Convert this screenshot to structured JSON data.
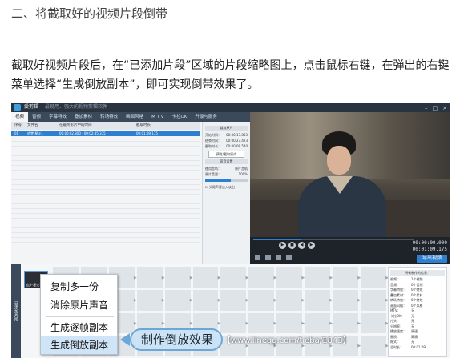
{
  "article": {
    "heading": "二、将截取好的视频片段倒带",
    "paragraph": "截取好视频片段后，在“已添加片段”区域的片段缩略图上，点击鼠标右键，在弹出的右键菜单选择“生成倒放副本”，即可实现倒带效果了。"
  },
  "app": {
    "title": "爱剪辑",
    "subtitle": "最易用、强大的视频剪辑软件",
    "tabs": [
      "视频",
      "音频",
      "字幕特效",
      "叠加素材",
      "转场特效",
      "画面风格",
      "M T V",
      "卡拉OK",
      "升级与服务"
    ],
    "table_headers": [
      "序号",
      "文件名",
      "在最终影片中的时间",
      "截取时长"
    ],
    "selected_row": [
      "01",
      "追梦·星火1",
      "00:00:02.800 - 00:02:35.375",
      "00:01:09.175"
    ],
    "side_panel": {
      "section1": "裁剪原片",
      "start_label": "开始时间：",
      "start_value": "00:00:17.883",
      "end_label": "结束时间：",
      "end_value": "00:00:27.423",
      "dur_label": "截取时长：",
      "dur_value": "00:00:09.540",
      "preview_btn": "预览/截取原片",
      "section2": "声音设置",
      "track_label": "使用音轨：",
      "track_value": "原片音轨",
      "vol_label": "原片音量：",
      "vol_value": "100%",
      "checkbox": "头尾声音淡入淡出"
    },
    "add_button": "添加视频",
    "delete_button": "删除",
    "confirm_button": "确认修改",
    "time_current": "00:00:00.000",
    "time_total": "00:01:09.175",
    "export_button": "导出视频",
    "timeline_label": "已添加片段",
    "thumb_label": "追梦·星火1",
    "info": {
      "title": "所有制作的信息：",
      "lines": [
        [
          "视频：",
          "1个视频"
        ],
        [
          "音频：",
          "0个音频"
        ],
        [
          "字幕特效：",
          "0个特效"
        ],
        [
          "叠加素材：",
          "0个素材"
        ],
        [
          "转场特效：",
          "0个特效"
        ],
        [
          "画面风格：",
          "0个风格"
        ],
        [
          "MTV：",
          "无"
        ],
        [
          "卡拉OK：",
          "无"
        ],
        [
          "片头：",
          "无"
        ],
        [
          "分辨率：",
          "无"
        ],
        [
          "播放速度：",
          "原速"
        ],
        [
          "画质：",
          "高清"
        ],
        [
          "格式：",
          "无"
        ],
        [
          "总时长：",
          "00:01:09"
        ]
      ]
    }
  },
  "context_menu": {
    "items": [
      "复制多一份",
      "消除原片声音",
      "生成逐帧副本",
      "生成倒放副本"
    ],
    "highlighted": "生成倒放副本"
  },
  "watermark": {
    "callout": "制作倒放效果",
    "site": "【www.lineqg.com/tieba/1843】"
  },
  "colors": {
    "accent": "#2f7fd0",
    "menu_highlight": "#cfe4f7",
    "app_dark": "#1b1f24"
  }
}
